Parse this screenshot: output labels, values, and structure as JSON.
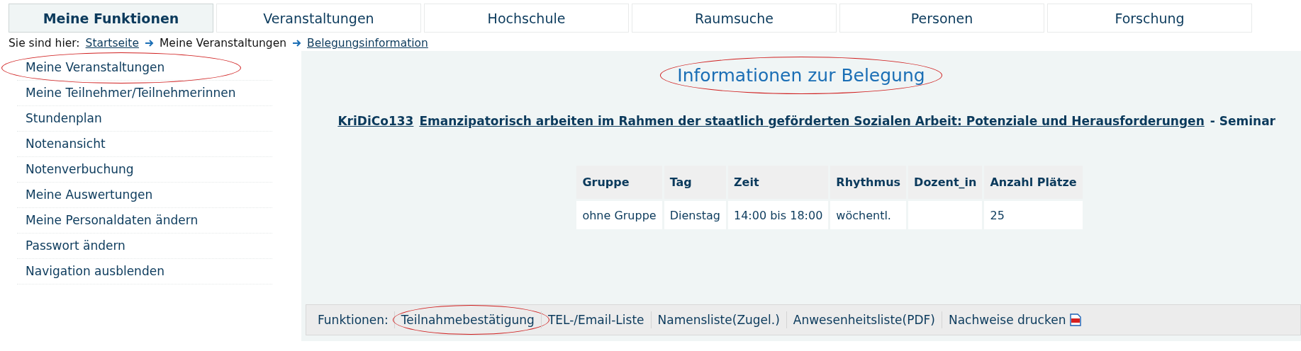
{
  "tabs": [
    {
      "label": "Meine Funktionen",
      "selected": true
    },
    {
      "label": "Veranstaltungen",
      "selected": false
    },
    {
      "label": "Hochschule",
      "selected": false
    },
    {
      "label": "Raumsuche",
      "selected": false
    },
    {
      "label": "Personen",
      "selected": false
    },
    {
      "label": "Forschung",
      "selected": false
    }
  ],
  "breadcrumb": {
    "prefix": "Sie sind hier:",
    "items": [
      {
        "label": "Startseite",
        "link": true
      },
      {
        "label": "Meine Veranstaltungen",
        "link": false
      },
      {
        "label": "Belegungsinformation",
        "link": true
      }
    ]
  },
  "sidebar": {
    "items": [
      {
        "label": "Meine Veranstaltungen",
        "circled": true
      },
      {
        "label": "Meine Teilnehmer/Teilnehmerinnen",
        "circled": false
      },
      {
        "label": "Stundenplan",
        "circled": false
      },
      {
        "label": "Notenansicht",
        "circled": false
      },
      {
        "label": "Notenverbuchung",
        "circled": false
      },
      {
        "label": "Meine Auswertungen",
        "circled": false
      },
      {
        "label": "Meine Personaldaten ändern",
        "circled": false
      },
      {
        "label": "Passwort ändern",
        "circled": false
      },
      {
        "label": "Navigation ausblenden",
        "circled": false
      }
    ]
  },
  "content": {
    "title": {
      "text": "Informationen zur Belegung",
      "circled": true
    },
    "course": {
      "number": "KriDiCo133",
      "name": "Emanzipatorisch arbeiten im Rahmen der staatlich geförderten Sozialen Arbeit: Potenziale und Herausforderungen",
      "type": "- Seminar"
    },
    "table": {
      "columns": [
        "Gruppe",
        "Tag",
        "Zeit",
        "Rhythmus",
        "Dozent_in",
        "Anzahl Plätze"
      ],
      "rows": [
        [
          "ohne Gruppe",
          "Dienstag",
          "14:00 bis 18:00",
          "wöchentl.",
          "",
          "25"
        ]
      ]
    },
    "functions": {
      "label": "Funktionen:",
      "items": [
        {
          "label": "Teilnahmebestätigung",
          "circled": true,
          "kind": "text"
        },
        {
          "label": "TEL-/Email-Liste",
          "circled": false,
          "kind": "text"
        },
        {
          "label": "Namensliste(Zugel.)",
          "circled": false,
          "kind": "text"
        },
        {
          "label": "Anwesenheitsliste(PDF)",
          "circled": false,
          "kind": "text"
        },
        {
          "label": "Nachweise drucken",
          "circled": false,
          "kind": "pdf"
        }
      ]
    }
  }
}
